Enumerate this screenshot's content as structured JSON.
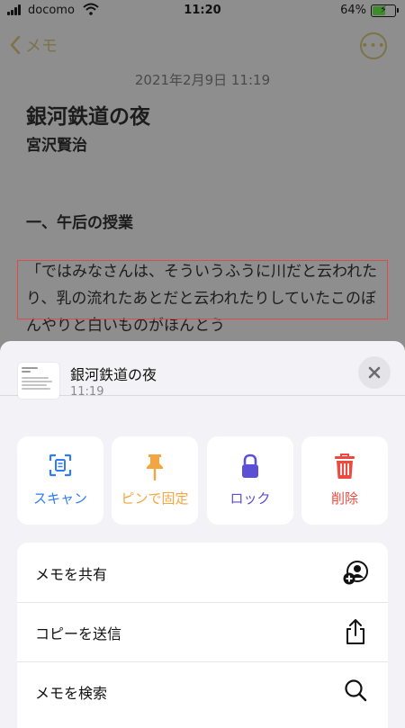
{
  "status_bar": {
    "carrier": "docomo",
    "time": "11:20",
    "battery_percent": "64%",
    "battery_level": 0.64
  },
  "nav": {
    "back_label": "メモ",
    "more_icon": "ellipsis-circle-icon"
  },
  "note": {
    "date": "2021年2月9日 11:19",
    "title": "銀河鉄道の夜",
    "author": "宮沢賢治",
    "heading": "一、午后の授業",
    "body": "「ではみなさんは、そういうふうに川だと云われたり、乳の流れたあとだと云われたりしていたこのぼんやりと白いものがほんとう"
  },
  "sheet": {
    "title": "銀河鉄道の夜",
    "time": "11:19",
    "actions": [
      {
        "label": "スキャン",
        "icon": "scan-icon",
        "color": "#2f7cf6"
      },
      {
        "label": "ピンで固定",
        "icon": "pin-icon",
        "color": "#f3a640"
      },
      {
        "label": "ロック",
        "icon": "lock-icon",
        "color": "#5b4fd6"
      },
      {
        "label": "削除",
        "icon": "trash-icon",
        "color": "#ec4a3f"
      }
    ],
    "rows": [
      {
        "label": "メモを共有",
        "icon": "person-add-icon"
      },
      {
        "label": "コピーを送信",
        "icon": "share-icon"
      },
      {
        "label": "メモを検索",
        "icon": "search-icon"
      }
    ]
  }
}
